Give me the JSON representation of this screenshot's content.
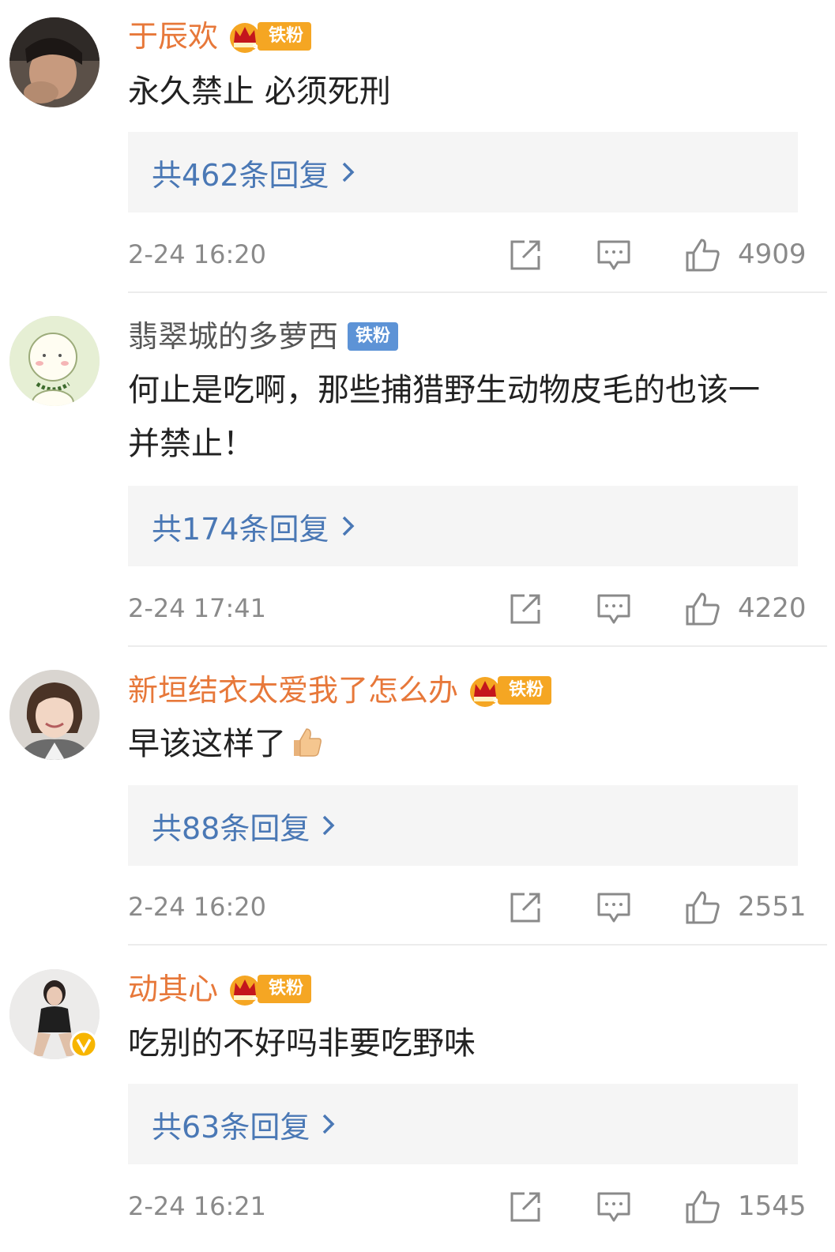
{
  "colors": {
    "vip_name": "#e7783a",
    "normal_name": "#555555",
    "reply_link": "#4a78b5",
    "meta": "#8a8a8a",
    "fan_gold": "#f5a623",
    "fan_blue": "#5d93d6"
  },
  "comments": [
    {
      "username": "于辰欢",
      "badge_level": "3",
      "badge_label": "铁粉",
      "text": "永久禁止 必须死刑",
      "reply_label": "共462条回复",
      "time": "2-24 16:20",
      "likes": "4909",
      "icon_share": "share-icon",
      "icon_reply": "comment-icon",
      "icon_like": "thumbs-up-icon"
    },
    {
      "username": "翡翠城的多萝西",
      "badge_label": "铁粉",
      "text": "何止是吃啊，那些捕猎野生动物皮毛的也该一并禁止！",
      "reply_label": "共174条回复",
      "time": "2-24 17:41",
      "likes": "4220"
    },
    {
      "username": "新垣结衣太爱我了怎么办",
      "badge_level": "3",
      "badge_label": "铁粉",
      "text": "早该这样了",
      "reply_label": "共88条回复",
      "time": "2-24 16:20",
      "likes": "2551"
    },
    {
      "username": "动其心",
      "badge_level": "2",
      "badge_label": "铁粉",
      "text": "吃别的不好吗非要吃野味",
      "reply_label": "共63条回复",
      "time": "2-24 16:21",
      "likes": "1545"
    }
  ]
}
